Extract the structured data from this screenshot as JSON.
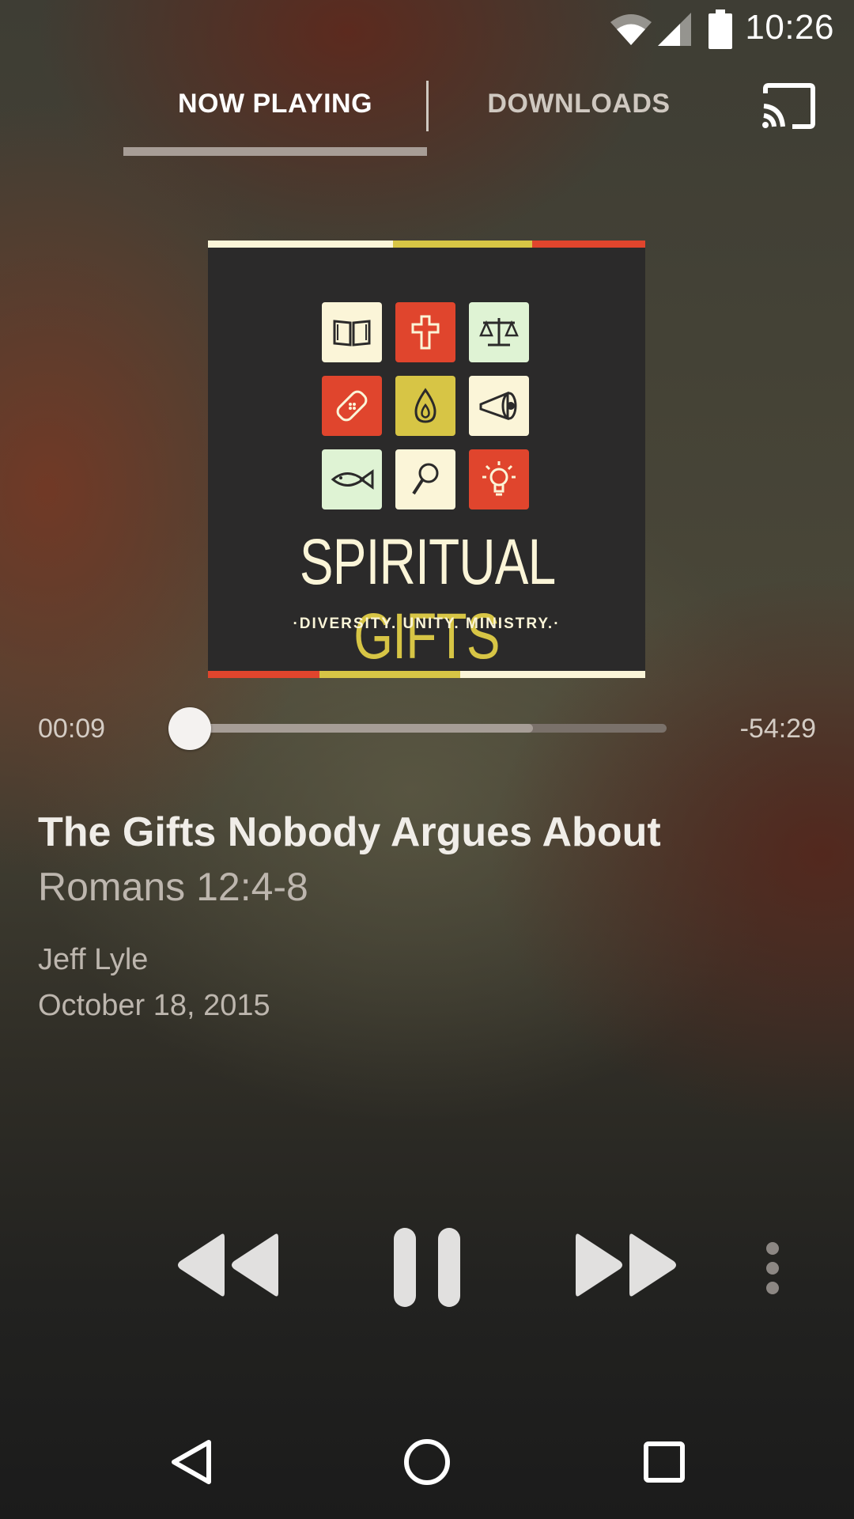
{
  "status_bar": {
    "time": "10:26",
    "icons": [
      "wifi-icon",
      "cell-signal-icon",
      "battery-icon"
    ]
  },
  "tabs": {
    "now_playing": "NOW PLAYING",
    "downloads": "DOWNLOADS",
    "active": "now_playing",
    "cast_icon": "cast-icon"
  },
  "album_art": {
    "title_word1": "SPIRITUAL",
    "title_word2": "GIFTS",
    "subtitle": "·DIVERSITY. UNITY. MINISTRY.·",
    "icons": [
      "open-book-icon",
      "cross-icon",
      "scales-icon",
      "bandage-icon",
      "flame-icon",
      "megaphone-icon",
      "fish-icon",
      "magnifier-icon",
      "lightbulb-icon"
    ],
    "colors": {
      "background": "#2b2a2a",
      "cream": "#fbf5d8",
      "red": "#e0452d",
      "yellow": "#d7c545",
      "mint": "#dff3d4"
    }
  },
  "player": {
    "elapsed": "00:09",
    "remaining": "-54:29",
    "progress_fraction": 0.003,
    "buffered_fraction": 0.72
  },
  "episode": {
    "title": "The Gifts Nobody Argues About",
    "subtitle": "Romans 12:4-8",
    "speaker": "Jeff Lyle",
    "date": "October 18, 2015"
  },
  "controls": [
    "rewind-icon",
    "pause-icon",
    "fast-forward-icon",
    "more-vert-icon"
  ],
  "nav_bar": [
    "back-icon",
    "home-icon",
    "recents-icon"
  ]
}
